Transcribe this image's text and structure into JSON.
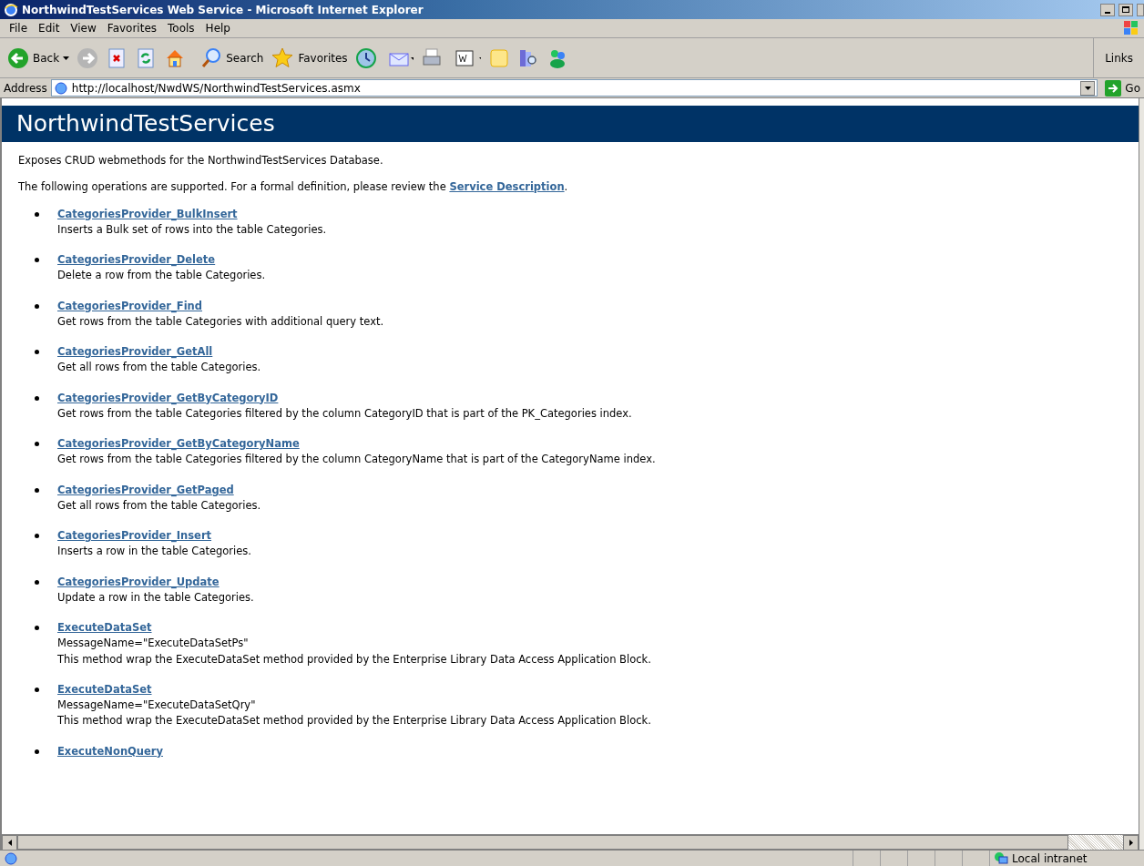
{
  "window": {
    "title": "NorthwindTestServices Web Service - Microsoft Internet Explorer"
  },
  "menu": [
    "File",
    "Edit",
    "View",
    "Favorites",
    "Tools",
    "Help"
  ],
  "toolbar": {
    "back_label": "Back",
    "search_label": "Search",
    "favorites_label": "Favorites",
    "links_label": "Links"
  },
  "address": {
    "label": "Address",
    "value": "http://localhost/NwdWS/NorthwindTestServices.asmx",
    "go_label": "Go"
  },
  "page": {
    "heading": "NorthwindTestServices",
    "description": "Exposes CRUD webmethods for the NorthwindTestServices Database.",
    "intro_before": "The following operations are supported. For a formal definition, please review the ",
    "intro_link": "Service Description",
    "intro_after": ".",
    "operations": [
      {
        "name": "CategoriesProvider_BulkInsert",
        "description": "Inserts a Bulk set of rows into the table Categories."
      },
      {
        "name": "CategoriesProvider_Delete",
        "description": "Delete a row from the table Categories."
      },
      {
        "name": "CategoriesProvider_Find",
        "description": "Get rows from the table Categories with additional query text."
      },
      {
        "name": "CategoriesProvider_GetAll",
        "description": "Get all rows from the table Categories."
      },
      {
        "name": "CategoriesProvider_GetByCategoryID",
        "description": "Get rows from the table Categories filtered by the column CategoryID that is part of the PK_Categories index."
      },
      {
        "name": "CategoriesProvider_GetByCategoryName",
        "description": "Get rows from the table Categories filtered by the column CategoryName that is part of the CategoryName index."
      },
      {
        "name": "CategoriesProvider_GetPaged",
        "description": "Get all rows from the table Categories."
      },
      {
        "name": "CategoriesProvider_Insert",
        "description": "Inserts a row in the table Categories."
      },
      {
        "name": "CategoriesProvider_Update",
        "description": "Update a row in the table Categories."
      },
      {
        "name": "ExecuteDataSet",
        "message_name": "MessageName=\"ExecuteDataSetPs\"",
        "description": "This method wrap the ExecuteDataSet method provided by the Enterprise Library Data Access Application Block."
      },
      {
        "name": "ExecuteDataSet",
        "message_name": "MessageName=\"ExecuteDataSetQry\"",
        "description": "This method wrap the ExecuteDataSet method provided by the Enterprise Library Data Access Application Block."
      },
      {
        "name": "ExecuteNonQuery"
      }
    ]
  },
  "status_bar": {
    "zone": "Local intranet"
  }
}
